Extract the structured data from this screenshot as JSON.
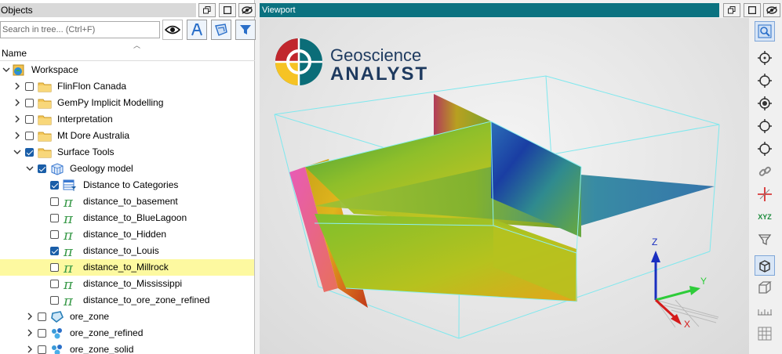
{
  "objects_panel": {
    "title": "Objects",
    "search_placeholder": "Search in tree... (Ctrl+F)",
    "column_header": "Name"
  },
  "tree": {
    "rows": [
      {
        "label": "Workspace",
        "level": 0,
        "chevron": "down",
        "checkbox": null,
        "icon": "workspace-icon"
      },
      {
        "label": "FlinFlon Canada",
        "level": 1,
        "chevron": "right",
        "checkbox": false,
        "icon": "folder-icon"
      },
      {
        "label": "GemPy Implicit Modelling",
        "level": 1,
        "chevron": "right",
        "checkbox": false,
        "icon": "folder-icon"
      },
      {
        "label": "Interpretation",
        "level": 1,
        "chevron": "right",
        "checkbox": false,
        "icon": "folder-icon"
      },
      {
        "label": "Mt Dore Australia",
        "level": 1,
        "chevron": "right",
        "checkbox": false,
        "icon": "folder-icon"
      },
      {
        "label": "Surface Tools",
        "level": 1,
        "chevron": "down",
        "checkbox": true,
        "icon": "folder-icon"
      },
      {
        "label": "Geology model",
        "level": 2,
        "chevron": "down",
        "checkbox": true,
        "icon": "block-model-icon"
      },
      {
        "label": "Distance to Categories",
        "level": 3,
        "chevron": null,
        "checkbox": true,
        "icon": "data-table-icon"
      },
      {
        "label": "distance_to_basement",
        "level": 3,
        "chevron": null,
        "checkbox": false,
        "icon": "pi-icon"
      },
      {
        "label": "distance_to_BlueLagoon",
        "level": 3,
        "chevron": null,
        "checkbox": false,
        "icon": "pi-icon"
      },
      {
        "label": "distance_to_Hidden",
        "level": 3,
        "chevron": null,
        "checkbox": false,
        "icon": "pi-icon"
      },
      {
        "label": "distance_to_Louis",
        "level": 3,
        "chevron": null,
        "checkbox": true,
        "icon": "pi-icon"
      },
      {
        "label": "distance_to_Millrock",
        "level": 3,
        "chevron": null,
        "checkbox": false,
        "icon": "pi-icon",
        "selected": true
      },
      {
        "label": "distance_to_Mississippi",
        "level": 3,
        "chevron": null,
        "checkbox": false,
        "icon": "pi-icon"
      },
      {
        "label": "distance_to_ore_zone_refined",
        "level": 3,
        "chevron": null,
        "checkbox": false,
        "icon": "pi-icon"
      },
      {
        "label": "ore_zone",
        "level": 2,
        "chevron": "right",
        "checkbox": false,
        "icon": "surface-icon"
      },
      {
        "label": "ore_zone_refined",
        "level": 2,
        "chevron": "right",
        "checkbox": false,
        "icon": "points-icon"
      },
      {
        "label": "ore_zone_solid",
        "level": 2,
        "chevron": "right",
        "checkbox": false,
        "icon": "points-icon"
      }
    ]
  },
  "viewport": {
    "title": "Viewport",
    "logo_line1": "Geoscience",
    "logo_line2": "ANALYST",
    "axis_x": "X",
    "axis_y": "Y",
    "axis_z": "Z",
    "brand_teal": "#0b6d78",
    "brand_red": "#c1272d",
    "brand_yellow": "#f6c324"
  },
  "toolbar": {
    "xyz_label": "XYZ"
  }
}
